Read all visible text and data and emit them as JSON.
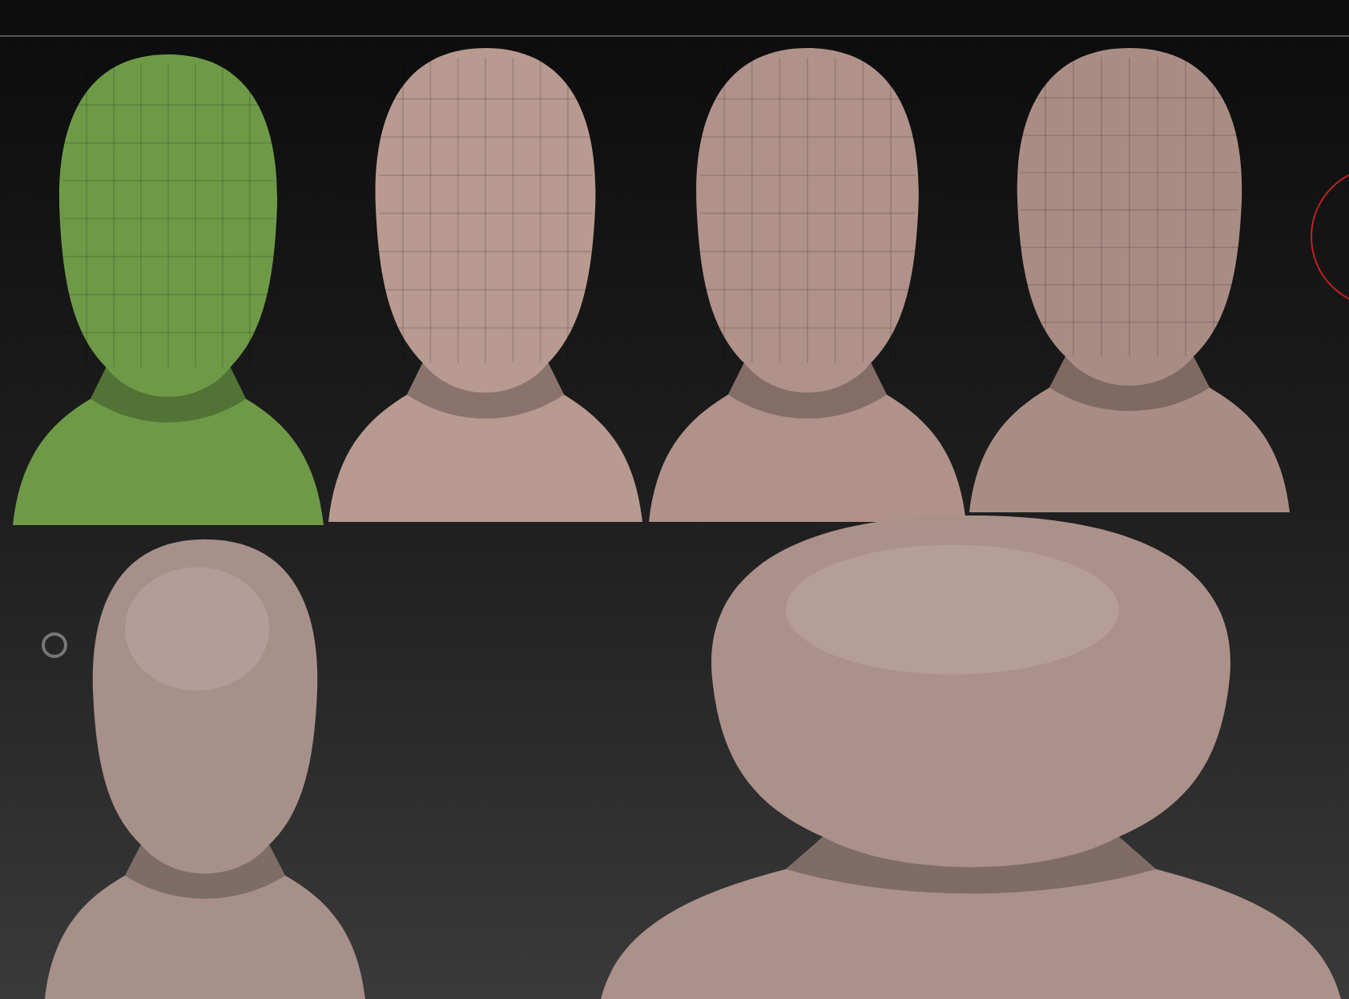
{
  "viewport": {
    "models": [
      {
        "kind": "faceted",
        "color": "#6e9a48"
      },
      {
        "kind": "faceted",
        "color": "#b89a90"
      },
      {
        "kind": "faceted",
        "color": "#b0928a"
      },
      {
        "kind": "faceted",
        "color": "#a98d85"
      },
      {
        "kind": "smooth",
        "color": "#a8908a"
      },
      {
        "kind": "smooth",
        "color": "#ab918a"
      }
    ]
  }
}
